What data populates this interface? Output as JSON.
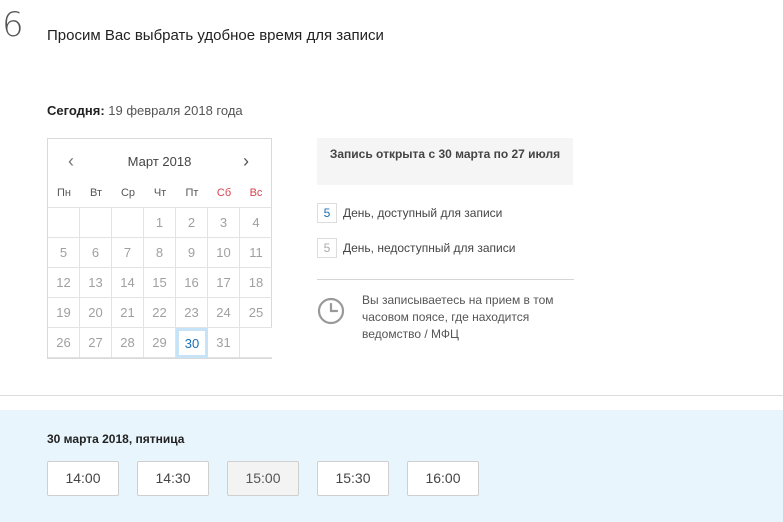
{
  "step": {
    "number": "6",
    "title": "Просим Вас выбрать удобное время для записи"
  },
  "today": {
    "label": "Сегодня:",
    "value": "19 февраля 2018 года"
  },
  "calendar": {
    "prev_icon": "chevron-left-icon",
    "next_icon": "chevron-right-icon",
    "month": "Март 2018",
    "weekdays": [
      "Пн",
      "Вт",
      "Ср",
      "Чт",
      "Пт",
      "Сб",
      "Вс"
    ],
    "weekend_color": "#d9434e",
    "available_color": "#1a6fb5",
    "days": [
      "",
      "",
      "",
      "1",
      "2",
      "3",
      "4",
      "5",
      "6",
      "7",
      "8",
      "9",
      "10",
      "11",
      "12",
      "13",
      "14",
      "15",
      "16",
      "17",
      "18",
      "19",
      "20",
      "21",
      "22",
      "23",
      "24",
      "25",
      "26",
      "27",
      "28",
      "29",
      "30",
      "31",
      ""
    ],
    "selected_day": "30"
  },
  "info": {
    "open_period": "Запись открыта с 30 марта по 27 июля"
  },
  "legend": {
    "available_sample": "5",
    "available_text": "День, доступный для записи",
    "unavailable_sample": "5",
    "unavailable_text": "День, недоступный для записи"
  },
  "timezone": {
    "icon": "clock-icon",
    "text": "Вы записываетесь на прием в том часовом поясе, где находится ведомство / МФЦ"
  },
  "slots": {
    "date": "30 марта 2018, пятница",
    "background": "#e9f5fc",
    "times": [
      "14:00",
      "14:30",
      "15:00",
      "15:30",
      "16:00"
    ],
    "disabled_time": "15:00"
  }
}
